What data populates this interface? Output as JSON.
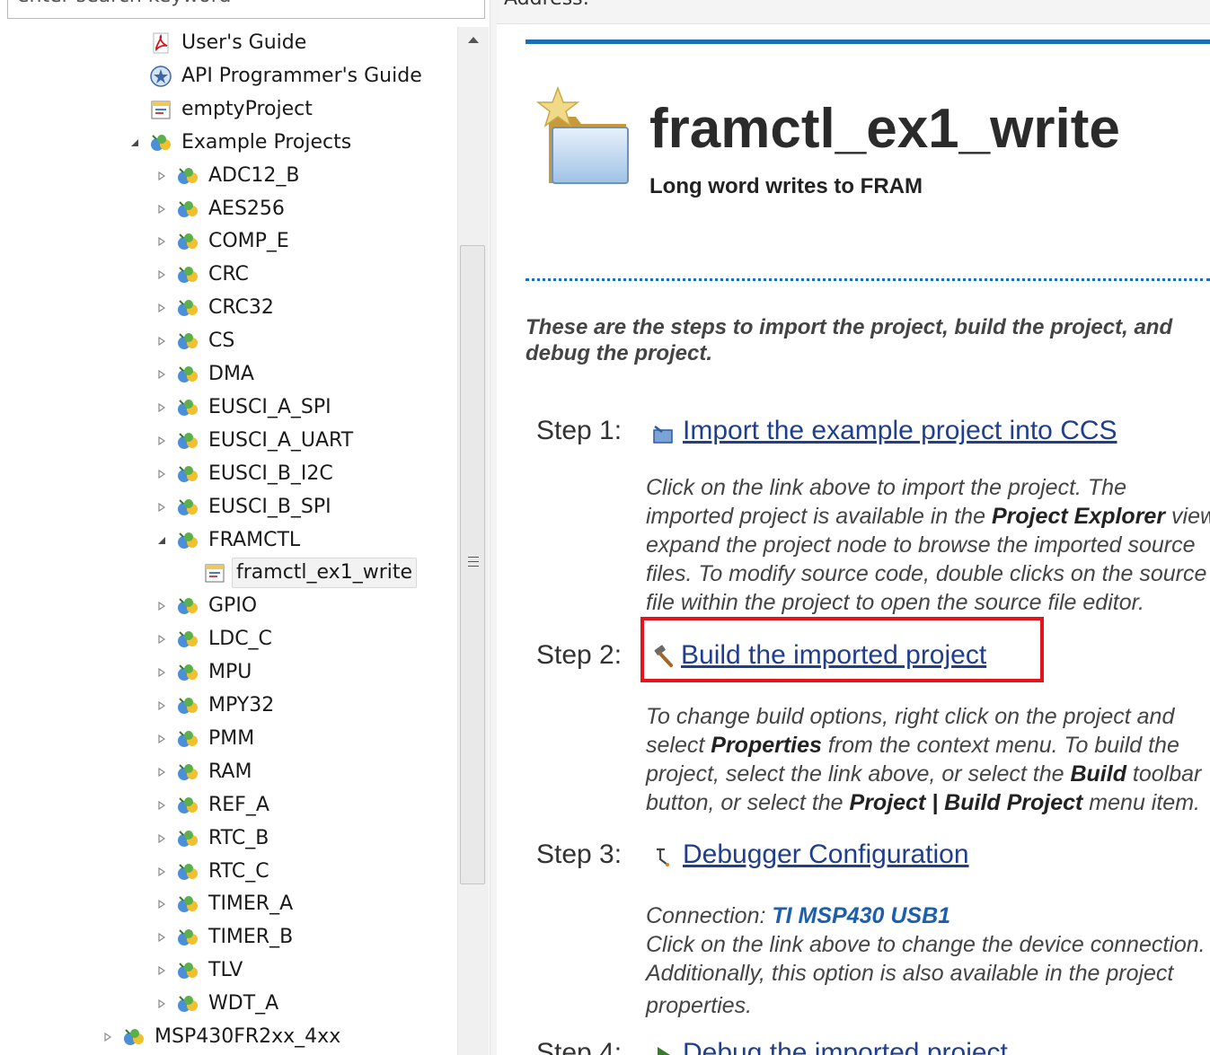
{
  "search": {
    "placeholder": "enter search keyword"
  },
  "tree": [
    {
      "label": "User's Guide",
      "icon": "pdf-icon",
      "depth": 0,
      "expander": "none"
    },
    {
      "label": "API Programmer's Guide",
      "icon": "api-guide-icon",
      "depth": 0,
      "expander": "none"
    },
    {
      "label": "emptyProject",
      "icon": "project-icon",
      "depth": 0,
      "expander": "none"
    },
    {
      "label": "Example Projects",
      "icon": "example-folder-icon",
      "depth": 0,
      "expander": "expanded"
    },
    {
      "label": "ADC12_B",
      "icon": "example-folder-icon",
      "depth": 1,
      "expander": "collapsed"
    },
    {
      "label": "AES256",
      "icon": "example-folder-icon",
      "depth": 1,
      "expander": "collapsed"
    },
    {
      "label": "COMP_E",
      "icon": "example-folder-icon",
      "depth": 1,
      "expander": "collapsed"
    },
    {
      "label": "CRC",
      "icon": "example-folder-icon",
      "depth": 1,
      "expander": "collapsed"
    },
    {
      "label": "CRC32",
      "icon": "example-folder-icon",
      "depth": 1,
      "expander": "collapsed"
    },
    {
      "label": "CS",
      "icon": "example-folder-icon",
      "depth": 1,
      "expander": "collapsed"
    },
    {
      "label": "DMA",
      "icon": "example-folder-icon",
      "depth": 1,
      "expander": "collapsed"
    },
    {
      "label": "EUSCI_A_SPI",
      "icon": "example-folder-icon",
      "depth": 1,
      "expander": "collapsed"
    },
    {
      "label": "EUSCI_A_UART",
      "icon": "example-folder-icon",
      "depth": 1,
      "expander": "collapsed"
    },
    {
      "label": "EUSCI_B_I2C",
      "icon": "example-folder-icon",
      "depth": 1,
      "expander": "collapsed"
    },
    {
      "label": "EUSCI_B_SPI",
      "icon": "example-folder-icon",
      "depth": 1,
      "expander": "collapsed"
    },
    {
      "label": "FRAMCTL",
      "icon": "example-folder-icon",
      "depth": 1,
      "expander": "expanded"
    },
    {
      "label": "framctl_ex1_write",
      "icon": "project-icon",
      "depth": 2,
      "expander": "none",
      "selected": true
    },
    {
      "label": "GPIO",
      "icon": "example-folder-icon",
      "depth": 1,
      "expander": "collapsed"
    },
    {
      "label": "LDC_C",
      "icon": "example-folder-icon",
      "depth": 1,
      "expander": "collapsed"
    },
    {
      "label": "MPU",
      "icon": "example-folder-icon",
      "depth": 1,
      "expander": "collapsed"
    },
    {
      "label": "MPY32",
      "icon": "example-folder-icon",
      "depth": 1,
      "expander": "collapsed"
    },
    {
      "label": "PMM",
      "icon": "example-folder-icon",
      "depth": 1,
      "expander": "collapsed"
    },
    {
      "label": "RAM",
      "icon": "example-folder-icon",
      "depth": 1,
      "expander": "collapsed"
    },
    {
      "label": "REF_A",
      "icon": "example-folder-icon",
      "depth": 1,
      "expander": "collapsed"
    },
    {
      "label": "RTC_B",
      "icon": "example-folder-icon",
      "depth": 1,
      "expander": "collapsed"
    },
    {
      "label": "RTC_C",
      "icon": "example-folder-icon",
      "depth": 1,
      "expander": "collapsed"
    },
    {
      "label": "TIMER_A",
      "icon": "example-folder-icon",
      "depth": 1,
      "expander": "collapsed"
    },
    {
      "label": "TIMER_B",
      "icon": "example-folder-icon",
      "depth": 1,
      "expander": "collapsed"
    },
    {
      "label": "TLV",
      "icon": "example-folder-icon",
      "depth": 1,
      "expander": "collapsed"
    },
    {
      "label": "WDT_A",
      "icon": "example-folder-icon",
      "depth": 1,
      "expander": "collapsed"
    },
    {
      "label": "MSP430FR2xx_4xx",
      "icon": "example-folder-icon",
      "depth": -1,
      "expander": "collapsed"
    }
  ],
  "address": {
    "label": "Address:"
  },
  "content": {
    "title": "framctl_ex1_write",
    "subtitle": "Long word writes to FRAM",
    "intro": "These are the steps to import the project, build the project, and debug the project.",
    "steps": [
      {
        "label": "Step 1:",
        "link": "Import the example project into CCS",
        "icon": "import-icon"
      },
      {
        "label": "Step 2:",
        "link": "Build the imported project",
        "icon": "hammer-icon"
      },
      {
        "label": "Step 3:",
        "link": "Debugger Configuration",
        "icon": "debug-config-icon"
      },
      {
        "label": "Step 4:",
        "link": "Debug the imported project",
        "icon": "debug-icon"
      }
    ],
    "step1_text": {
      "l1": "Click on the link above to import the project. The",
      "l2a": "imported project is available in the ",
      "l2b": "Project Explorer",
      "l2c": " view.",
      "l3": "expand the project node to browse the imported source",
      "l4": "files. To modify source code, double clicks on the source",
      "l5": "file within the project to open the source file editor."
    },
    "step2_text": {
      "l1": "To change build options, right click on the project and",
      "l2a": "select ",
      "l2b": "Properties",
      "l2c": " from the context menu. To build the",
      "l3a": "project, select the link above, or select the ",
      "l3b": "Build",
      "l3c": " toolbar",
      "l4a": "button, or select the ",
      "l4b": "Project | Build Project",
      "l4c": " menu item."
    },
    "step3_text": {
      "conn_label": "Connection: ",
      "conn_value": "TI MSP430 USB1",
      "l2": "Click on the link above to change the device connection.",
      "l3": "Additionally, this option is also available in the project",
      "l4": "properties."
    }
  },
  "colors": {
    "accent": "#1c6fb5",
    "link": "#1f3e8c",
    "highlight": "#e3141c",
    "connection": "#1b5fae"
  }
}
